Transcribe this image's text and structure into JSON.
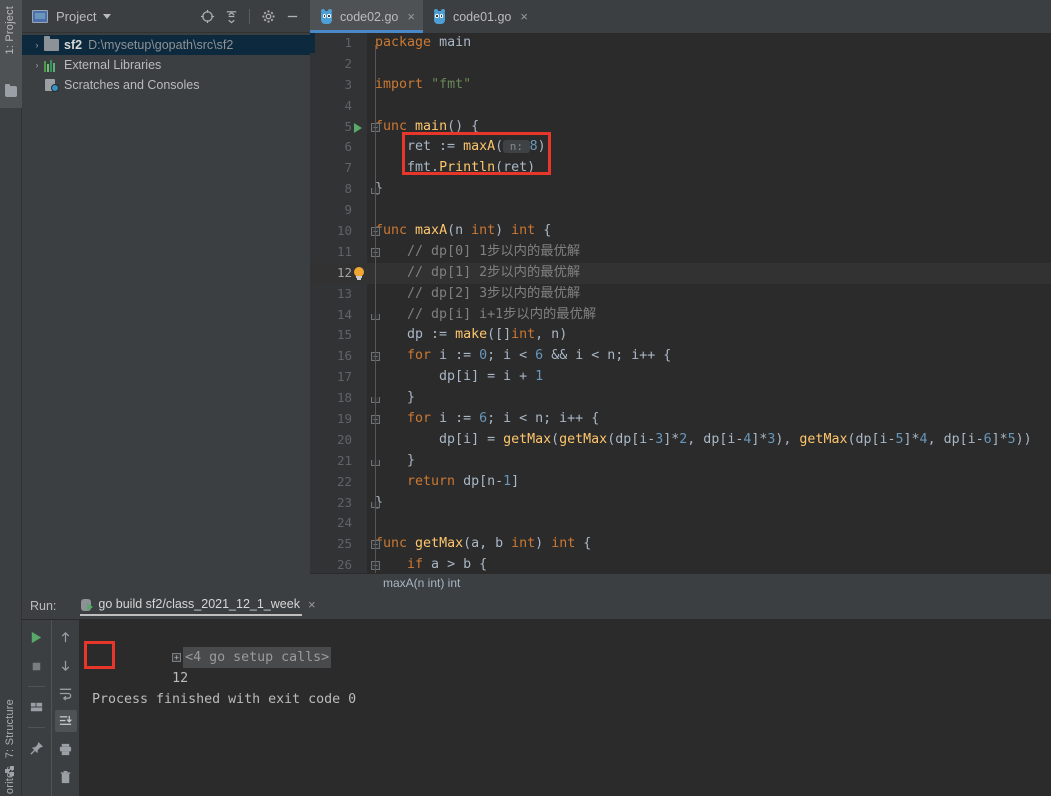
{
  "rail": {
    "project_label": "1: Project",
    "structure_label": "7: Structure",
    "favorites_label": "orites"
  },
  "project_panel": {
    "title": "Project",
    "caret_icon": "chevron-down-icon",
    "tools": [
      {
        "name": "locate-icon",
        "label": "⊕"
      },
      {
        "name": "collapse-all-icon",
        "label": "⇥"
      },
      {
        "name": "settings-gear-icon",
        "label": "⚙"
      },
      {
        "name": "hide-panel-icon",
        "label": "—"
      }
    ],
    "tree": [
      {
        "name": "sf2",
        "path": "D:\\mysetup\\gopath\\src\\sf2",
        "icon": "folder-icon",
        "arrow": "›",
        "selected": true
      },
      {
        "name": "External Libraries",
        "path": "",
        "icon": "library-bars-icon",
        "arrow": "›",
        "selected": false
      },
      {
        "name": "Scratches and Consoles",
        "path": "",
        "icon": "scratches-icon",
        "arrow": "",
        "selected": false
      }
    ]
  },
  "tabs": [
    {
      "label": "code02.go",
      "icon": "go-file-icon",
      "close": "×",
      "active": true
    },
    {
      "label": "code01.go",
      "icon": "go-file-icon",
      "close": "×",
      "active": false
    }
  ],
  "editor": {
    "breadcrumb": "maxA(n int) int",
    "lines": [
      {
        "n": "1",
        "html": "<span class=\"kw\">package</span> <span class=\"pln\">main</span>",
        "gutter": "",
        "fold": "",
        "hl": false
      },
      {
        "n": "2",
        "html": "",
        "gutter": "",
        "fold": "",
        "hl": false
      },
      {
        "n": "3",
        "html": "<span class=\"kw\">import</span> <span class=\"str\">\"fmt\"</span>",
        "gutter": "",
        "fold": "",
        "hl": false
      },
      {
        "n": "4",
        "html": "",
        "gutter": "",
        "fold": "",
        "hl": false
      },
      {
        "n": "5",
        "html": "<span class=\"kw\">func</span> <span class=\"fn\">main</span><span class=\"pln\">() {</span>",
        "gutter": "run-arrow",
        "fold": "open",
        "hl": false
      },
      {
        "n": "6",
        "html": "    <span class=\"pln\">ret := </span><span class=\"fn\">maxA</span><span class=\"pln\">(</span><span class=\"hint\"> n: </span><span class=\"num\">8</span><span class=\"pln\">)</span>",
        "gutter": "",
        "fold": "",
        "hl": false
      },
      {
        "n": "7",
        "html": "    <span class=\"pln\">fmt.</span><span class=\"fn\">Println</span><span class=\"pln\">(ret)</span>",
        "gutter": "",
        "fold": "",
        "hl": false
      },
      {
        "n": "8",
        "html": "<span class=\"pln\">}</span>",
        "gutter": "",
        "fold": "close",
        "hl": false
      },
      {
        "n": "9",
        "html": "",
        "gutter": "",
        "fold": "",
        "hl": false
      },
      {
        "n": "10",
        "html": "<span class=\"kw\">func</span> <span class=\"fn\">maxA</span><span class=\"pln\">(n </span><span class=\"kw\">int</span><span class=\"pln\">) </span><span class=\"kw\">int</span><span class=\"pln\"> {</span>",
        "gutter": "",
        "fold": "open",
        "hl": false
      },
      {
        "n": "11",
        "html": "    <span class=\"cmt\">// dp[0] 1步以内的最优解</span>",
        "gutter": "",
        "fold": "open",
        "hl": false
      },
      {
        "n": "12",
        "html": "    <span class=\"cmt\">// dp[1] 2步以内的最优解</span>",
        "gutter": "bulb",
        "fold": "",
        "hl": true
      },
      {
        "n": "13",
        "html": "    <span class=\"cmt\">// dp[2] 3步以内的最优解</span>",
        "gutter": "",
        "fold": "",
        "hl": false
      },
      {
        "n": "14",
        "html": "    <span class=\"cmt\">// dp[i] i+1步以内的最优解</span>",
        "gutter": "",
        "fold": "close",
        "hl": false
      },
      {
        "n": "15",
        "html": "    <span class=\"pln\">dp := </span><span class=\"fn\">make</span><span class=\"pln\">([]</span><span class=\"kw\">int</span><span class=\"pln\">, n)</span>",
        "gutter": "",
        "fold": "",
        "hl": false
      },
      {
        "n": "16",
        "html": "    <span class=\"kw\">for</span><span class=\"pln\"> i := </span><span class=\"num\">0</span><span class=\"pln\">; i &lt; </span><span class=\"num\">6</span><span class=\"pln\"> &amp;&amp; i &lt; n; i++ {</span>",
        "gutter": "",
        "fold": "open",
        "hl": false
      },
      {
        "n": "17",
        "html": "        <span class=\"pln\">dp[i] = i + </span><span class=\"num\">1</span>",
        "gutter": "",
        "fold": "",
        "hl": false
      },
      {
        "n": "18",
        "html": "    <span class=\"pln\">}</span>",
        "gutter": "",
        "fold": "close",
        "hl": false
      },
      {
        "n": "19",
        "html": "    <span class=\"kw\">for</span><span class=\"pln\"> i := </span><span class=\"num\">6</span><span class=\"pln\">; i &lt; n; i++ {</span>",
        "gutter": "",
        "fold": "open",
        "hl": false
      },
      {
        "n": "20",
        "html": "        <span class=\"pln\">dp[i] = </span><span class=\"fn\">getMax</span><span class=\"pln\">(</span><span class=\"fn\">getMax</span><span class=\"pln\">(dp[i-</span><span class=\"num\">3</span><span class=\"pln\">]*</span><span class=\"num\">2</span><span class=\"pln\">, dp[i-</span><span class=\"num\">4</span><span class=\"pln\">]*</span><span class=\"num\">3</span><span class=\"pln\">), </span><span class=\"fn\">getMax</span><span class=\"pln\">(dp[i-</span><span class=\"num\">5</span><span class=\"pln\">]*</span><span class=\"num\">4</span><span class=\"pln\">, dp[i-</span><span class=\"num\">6</span><span class=\"pln\">]*</span><span class=\"num\">5</span><span class=\"pln\">))</span>",
        "gutter": "",
        "fold": "",
        "hl": false
      },
      {
        "n": "21",
        "html": "    <span class=\"pln\">}</span>",
        "gutter": "",
        "fold": "close",
        "hl": false
      },
      {
        "n": "22",
        "html": "    <span class=\"kw\">return</span><span class=\"pln\"> dp[n-</span><span class=\"num\">1</span><span class=\"pln\">]</span>",
        "gutter": "",
        "fold": "",
        "hl": false
      },
      {
        "n": "23",
        "html": "<span class=\"pln\">}</span>",
        "gutter": "",
        "fold": "close",
        "hl": false
      },
      {
        "n": "24",
        "html": "",
        "gutter": "",
        "fold": "",
        "hl": false
      },
      {
        "n": "25",
        "html": "<span class=\"kw\">func</span> <span class=\"fn\">getMax</span><span class=\"pln\">(a, b </span><span class=\"kw\">int</span><span class=\"pln\">) </span><span class=\"kw\">int</span><span class=\"pln\"> {</span>",
        "gutter": "",
        "fold": "open",
        "hl": false
      },
      {
        "n": "26",
        "html": "    <span class=\"kw\">if</span><span class=\"pln\"> a &gt; b {</span>",
        "gutter": "",
        "fold": "open",
        "hl": false
      }
    ],
    "annotation_color": "#e8372a"
  },
  "run_panel": {
    "label": "Run:",
    "tab_label": "go build sf2/class_2021_12_1_week",
    "tab_close": "×",
    "toolbar_left": [
      {
        "name": "rerun-play-icon"
      },
      {
        "name": "stop-icon"
      },
      {
        "name": "layout-icon"
      },
      {
        "name": "pin-icon"
      }
    ],
    "toolbar_right": [
      {
        "name": "prev-occurrence-arrow-up-icon"
      },
      {
        "name": "next-occurrence-arrow-down-icon"
      },
      {
        "name": "soft-wrap-icon"
      },
      {
        "name": "scroll-to-end-icon"
      },
      {
        "name": "print-icon"
      },
      {
        "name": "clear-all-trash-icon"
      }
    ],
    "console": {
      "setup_line": "<4 go setup calls>",
      "expander": "+",
      "output_value": "12",
      "finished_line": "Process finished with exit code 0"
    }
  },
  "colors": {
    "accent": "#4a88c7",
    "annotation": "#e8372a",
    "editor_bg": "#2b2b2b",
    "chrome_bg": "#3c3f41",
    "selection": "#0d293e",
    "keyword": "#cc7832",
    "function": "#ffc66d",
    "string": "#6a8759",
    "number": "#6897bb",
    "comment": "#808080",
    "plain": "#a9b7c6",
    "green_run": "#59a869"
  }
}
